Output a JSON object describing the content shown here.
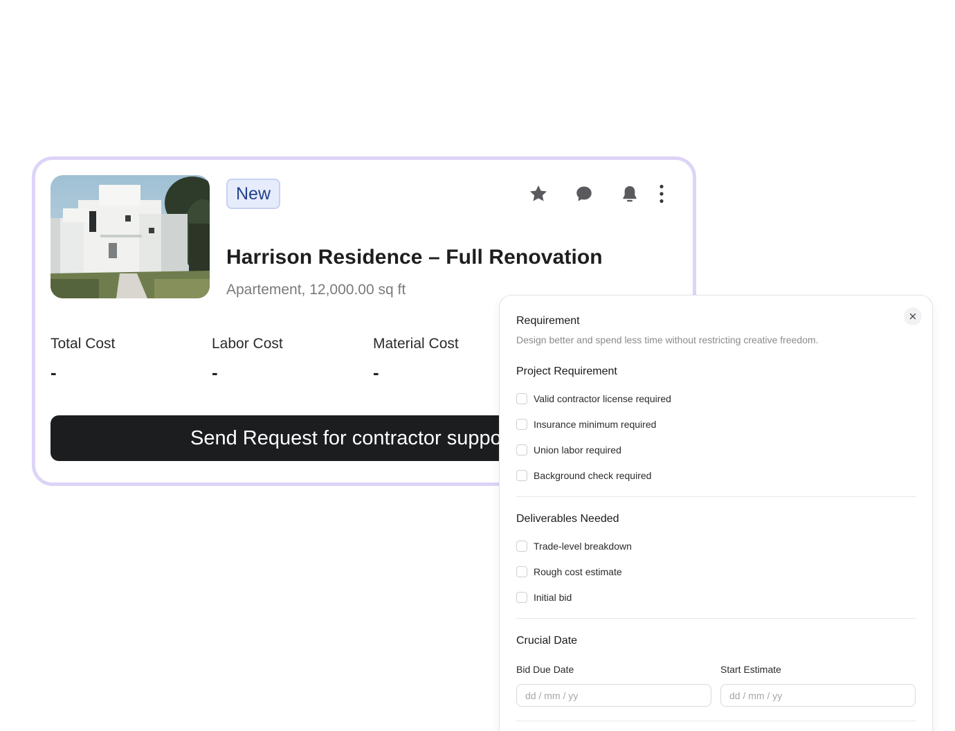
{
  "card": {
    "badge": "New",
    "title": "Harrison Residence – Full Renovation",
    "subtitle": "Apartement, 12,000.00 sq ft",
    "stats": [
      {
        "label": "Total Cost",
        "value": "-"
      },
      {
        "label": "Labor Cost",
        "value": "-"
      },
      {
        "label": "Material Cost",
        "value": "-"
      }
    ],
    "button_label": "Send Request for contractor support",
    "icons": [
      "star-icon",
      "comment-icon",
      "bell-icon",
      "more-vertical-icon"
    ],
    "border_color": "#ddd4f7",
    "badge_color": "#24418e"
  },
  "panel": {
    "title": "Requirement",
    "description": "Design better and spend less time without restricting creative freedom.",
    "project_requirement": {
      "title": "Project Requirement",
      "items": [
        "Valid contractor license required",
        "Insurance minimum required",
        "Union labor required",
        "Background check required"
      ]
    },
    "deliverables": {
      "title": "Deliverables Needed",
      "items": [
        "Trade-level breakdown",
        "Rough cost estimate",
        "Initial bid"
      ]
    },
    "crucial_date": {
      "title": "Crucial Date",
      "bid_due_label": "Bid Due Date",
      "bid_due_placeholder": "dd / mm / yy",
      "start_estimate_label": "Start Estimate",
      "start_estimate_placeholder": "dd / mm / yy"
    }
  }
}
